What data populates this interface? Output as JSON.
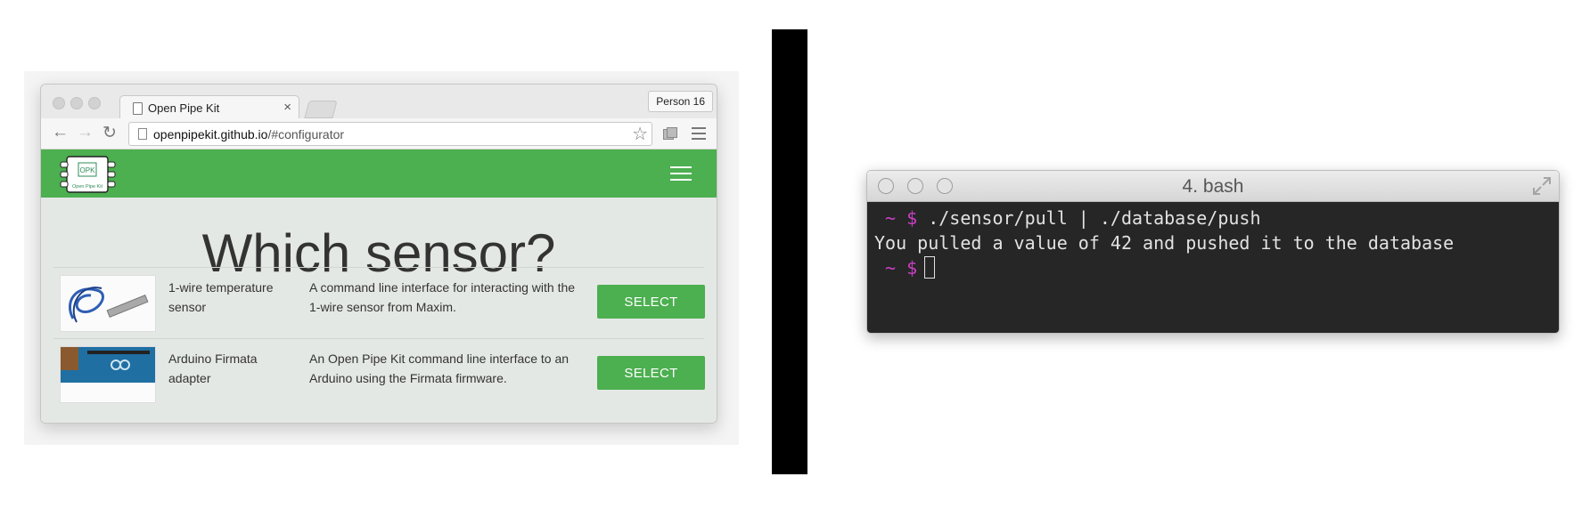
{
  "browser": {
    "tab_title": "Open Pipe Kit",
    "tab_close": "×",
    "profile_button": "Person 16",
    "back_glyph": "←",
    "forward_glyph": "→",
    "reload_glyph": "↻",
    "bookmark_glyph": "☆",
    "url_host": "openpipekit.github.io",
    "url_path": "/#configurator"
  },
  "page": {
    "logo_text": "OPK",
    "logo_subtext": "Open Pipe Kit",
    "heading": "Which sensor?",
    "accent_color": "#4caf50",
    "sensors": [
      {
        "name": "1-wire temperature sensor",
        "description": "A command line interface for interacting with the 1-wire sensor from Maxim.",
        "button": "SELECT"
      },
      {
        "name": "Arduino Firmata adapter",
        "description": "An Open Pipe Kit command line interface to an Arduino using the Firmata firmware.",
        "button": "SELECT"
      }
    ]
  },
  "terminal": {
    "title": "4. bash",
    "prompt_symbol": "~ $",
    "command": "./sensor/pull | ./database/push",
    "output": "You pulled a value of 42 and pushed it to the database",
    "prompt_color": "#cc3fc7"
  }
}
